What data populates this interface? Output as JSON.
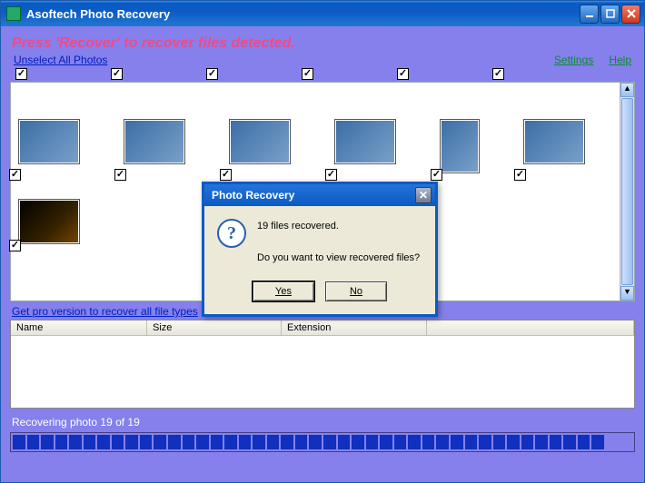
{
  "window": {
    "title": "Asoftech Photo Recovery"
  },
  "banner": "Press 'Recover' to recover files detected.",
  "links": {
    "unselect": "Unselect All Photos",
    "settings": "Settings",
    "help": "Help",
    "pro": "Get pro version to recover all file types"
  },
  "table": {
    "headers": {
      "name": "Name",
      "size": "Size",
      "ext": "Extension"
    }
  },
  "status": "Recovering photo 19 of 19",
  "progress": {
    "filled": 42,
    "total": 44
  },
  "dialog": {
    "title": "Photo Recovery",
    "line1": "19 files recovered.",
    "line2": "Do you want to view recovered files?",
    "yes": "Yes",
    "no": "No"
  }
}
